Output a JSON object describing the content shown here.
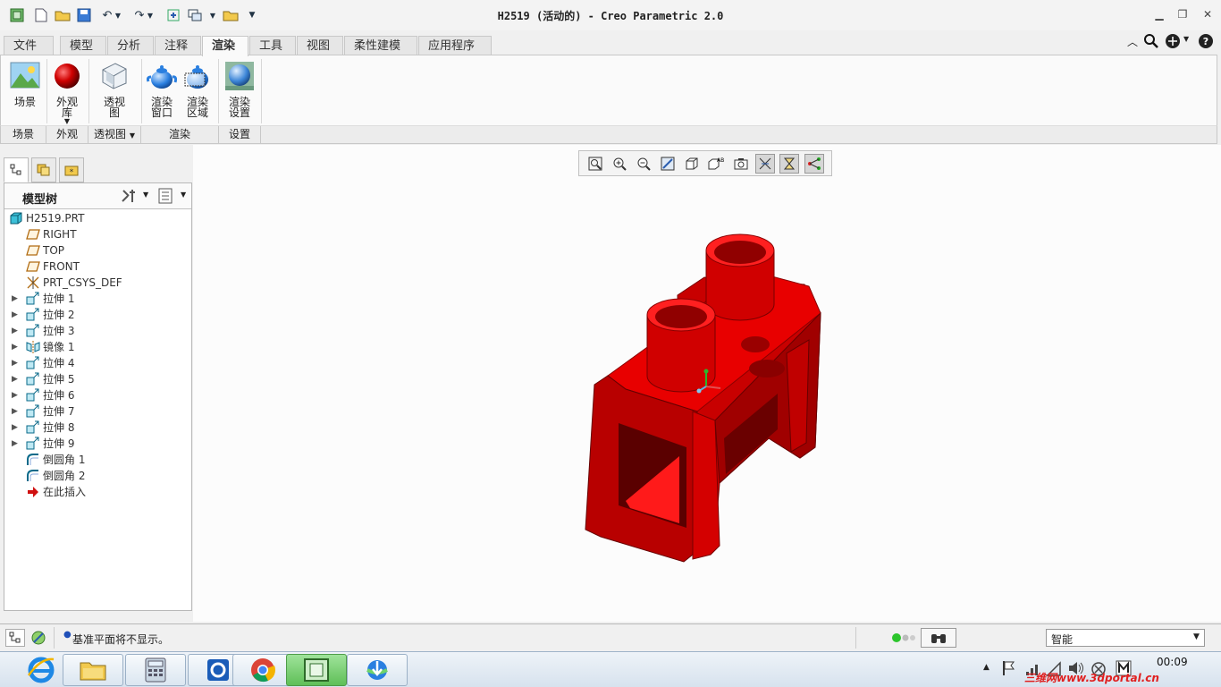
{
  "window": {
    "title": "H2519 (活动的) - Creo Parametric 2.0",
    "quick_access": [
      "new-icon",
      "open-icon",
      "save-icon",
      "undo-icon",
      "redo-icon",
      "regenerate-icon",
      "windows-icon",
      "close-window-icon",
      "customize-icon"
    ]
  },
  "tabs": [
    {
      "label": "文件",
      "active": false
    },
    {
      "label": "模型",
      "active": false
    },
    {
      "label": "分析",
      "active": false
    },
    {
      "label": "注释",
      "active": false
    },
    {
      "label": "渲染",
      "active": true
    },
    {
      "label": "工具",
      "active": false
    },
    {
      "label": "视图",
      "active": false
    },
    {
      "label": "柔性建模",
      "active": false
    },
    {
      "label": "应用程序",
      "active": false
    }
  ],
  "ribbon": {
    "buttons": [
      {
        "label": "场景",
        "icon": "scene-icon"
      },
      {
        "label": "外观\n库",
        "icon": "appearance-gallery-icon"
      },
      {
        "label": "透视\n图",
        "icon": "perspective-view-icon"
      },
      {
        "label": "渲染\n窗口",
        "icon": "render-window-icon"
      },
      {
        "label": "渲染\n区域",
        "icon": "render-region-icon"
      },
      {
        "label": "渲染\n设置",
        "icon": "render-setup-icon"
      }
    ],
    "groups": [
      "场景",
      "外观",
      "透视图",
      "渲染",
      "设置"
    ]
  },
  "view_toolbar": [
    "refit-icon",
    "zoom-in-icon",
    "zoom-out-icon",
    "repaint-icon",
    "display-style-icon",
    "saved-orientations-icon",
    "named-views-icon",
    "datum-display-icon",
    "spin-center-icon",
    "annotation-display-icon"
  ],
  "model_tree": {
    "title": "模型树",
    "items": [
      {
        "label": "H2519.PRT",
        "icon": "part-icon",
        "expand": false,
        "indent": 0
      },
      {
        "label": "RIGHT",
        "icon": "datum-plane-icon",
        "expand": false,
        "indent": 1
      },
      {
        "label": "TOP",
        "icon": "datum-plane-icon",
        "expand": false,
        "indent": 1
      },
      {
        "label": "FRONT",
        "icon": "datum-plane-icon",
        "expand": false,
        "indent": 1
      },
      {
        "label": "PRT_CSYS_DEF",
        "icon": "csys-icon",
        "expand": false,
        "indent": 1
      },
      {
        "label": "拉伸 1",
        "icon": "extrude-icon",
        "expand": true,
        "indent": 1
      },
      {
        "label": "拉伸 2",
        "icon": "extrude-icon",
        "expand": true,
        "indent": 1
      },
      {
        "label": "拉伸 3",
        "icon": "extrude-icon",
        "expand": true,
        "indent": 1
      },
      {
        "label": "镜像 1",
        "icon": "mirror-icon",
        "expand": true,
        "indent": 1
      },
      {
        "label": "拉伸 4",
        "icon": "extrude-icon",
        "expand": true,
        "indent": 1
      },
      {
        "label": "拉伸 5",
        "icon": "extrude-icon",
        "expand": true,
        "indent": 1
      },
      {
        "label": "拉伸 6",
        "icon": "extrude-icon",
        "expand": true,
        "indent": 1
      },
      {
        "label": "拉伸 7",
        "icon": "extrude-icon",
        "expand": true,
        "indent": 1
      },
      {
        "label": "拉伸 8",
        "icon": "extrude-icon",
        "expand": true,
        "indent": 1
      },
      {
        "label": "拉伸 9",
        "icon": "extrude-icon",
        "expand": true,
        "indent": 1
      },
      {
        "label": "倒圆角 1",
        "icon": "round-icon",
        "expand": false,
        "indent": 1
      },
      {
        "label": "倒圆角 2",
        "icon": "round-icon",
        "expand": false,
        "indent": 1
      },
      {
        "label": "在此插入",
        "icon": "insert-here-icon",
        "expand": false,
        "indent": 1
      }
    ]
  },
  "status": {
    "message": "基准平面将不显示。",
    "filter_value": "智能"
  },
  "taskbar": {
    "apps": [
      "ie-icon",
      "explorer-icon",
      "calculator-icon",
      "outlook-icon",
      "chrome-icon",
      "creo-icon",
      "download-icon"
    ],
    "clock": "00:09",
    "watermark": "三维网www.3dportal.cn"
  },
  "colors": {
    "model": "#e00000",
    "accent": "#2a6fc7"
  }
}
